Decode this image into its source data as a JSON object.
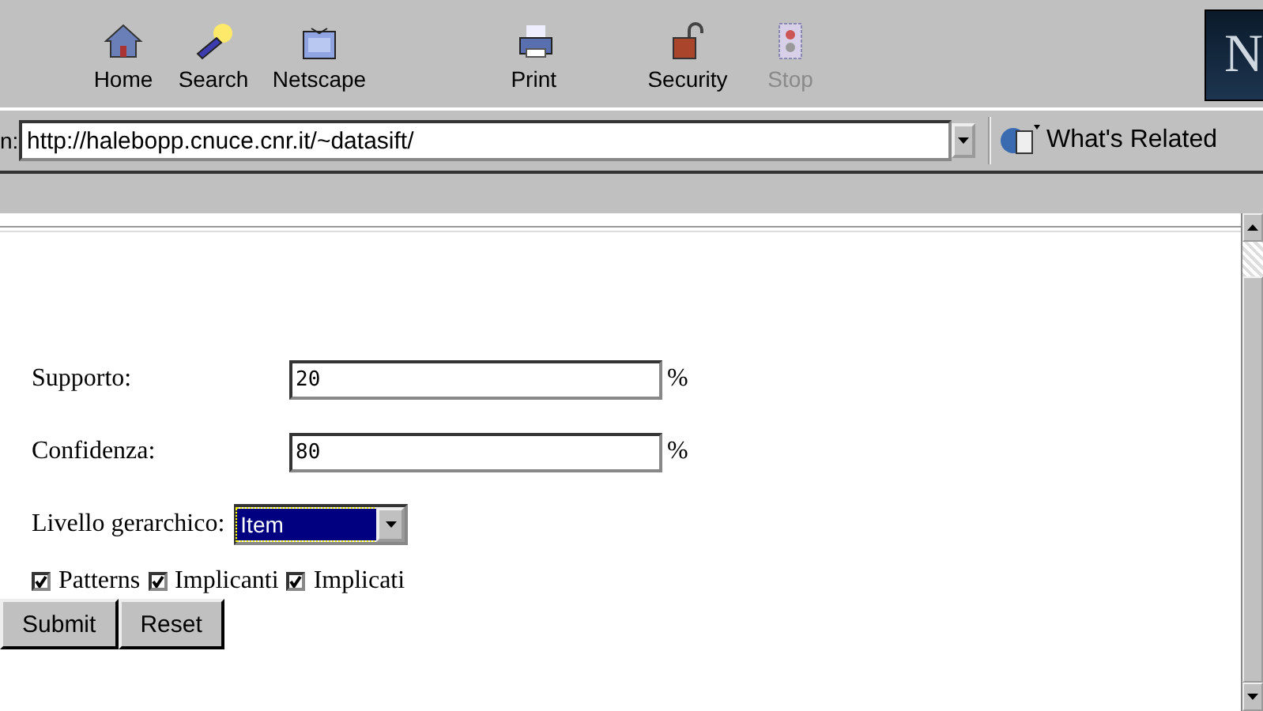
{
  "toolbar": {
    "buttons": [
      {
        "kind": "home",
        "label": "Home",
        "disabled": false
      },
      {
        "kind": "search",
        "label": "Search",
        "disabled": false
      },
      {
        "kind": "netscape",
        "label": "Netscape",
        "disabled": false
      },
      {
        "kind": "print",
        "label": "Print",
        "disabled": false
      },
      {
        "kind": "security",
        "label": "Security",
        "disabled": false
      },
      {
        "kind": "stop",
        "label": "Stop",
        "disabled": true
      }
    ],
    "logo": "N"
  },
  "location_bar": {
    "label": "n:",
    "url": "http://halebopp.cnuce.cnr.it/~datasift/",
    "related": "What's Related"
  },
  "form": {
    "fields": [
      {
        "label": "Supporto:",
        "value": "20",
        "unit": "%"
      },
      {
        "label": "Confidenza:",
        "value": "80",
        "unit": "%"
      }
    ],
    "select": {
      "label": "Livello gerarchico:",
      "value": "Item"
    },
    "checkboxes": [
      {
        "label": "Patterns",
        "checked": true
      },
      {
        "label": "Implicanti",
        "checked": true
      },
      {
        "label": "Implicati",
        "checked": true
      }
    ],
    "buttons": [
      "Submit",
      "Reset"
    ]
  }
}
